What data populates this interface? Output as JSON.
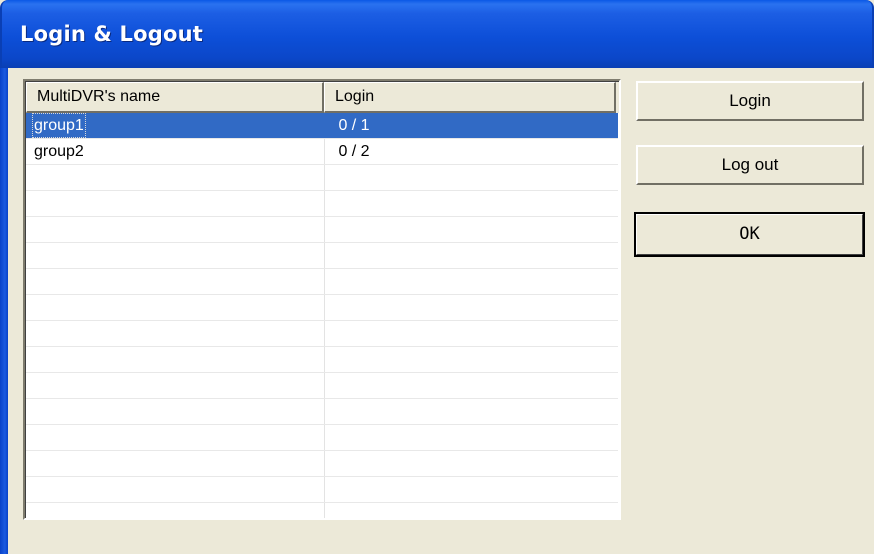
{
  "window": {
    "title": "Login & Logout"
  },
  "list": {
    "columns": [
      "MultiDVR's name",
      "Login"
    ],
    "rows": [
      {
        "name": "group1",
        "login": " 0 / 1",
        "selected": true
      },
      {
        "name": "group2",
        "login": " 0 / 2",
        "selected": false
      }
    ],
    "empty_row_count": 13
  },
  "buttons": {
    "login": "Login",
    "logout": "Log out",
    "ok": "OK"
  },
  "colors": {
    "titlebar": "#0b4fd8",
    "selection": "#316ac5",
    "dialog_face": "#ece9d8"
  }
}
